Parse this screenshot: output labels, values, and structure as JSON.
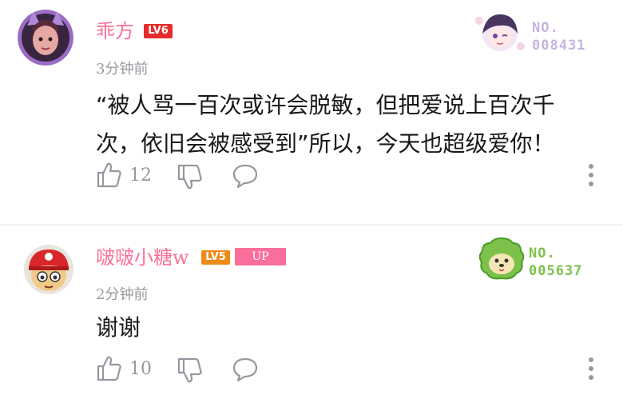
{
  "comments": [
    {
      "username": "乖方",
      "level": "LV6",
      "time": "3分钟前",
      "content": "“被人骂一百次或许会脱敏，但把爱说上百次千次，依旧会被感受到”所以，今天也超级爱你！",
      "likes": "12",
      "fan_no_label": "NO.",
      "fan_no_value": "008431"
    },
    {
      "username": "啵啵小糖w",
      "level": "LV5",
      "up_badge": "UP",
      "time": "2分钟前",
      "content": "谢谢",
      "likes": "10",
      "fan_no_label": "NO.",
      "fan_no_value": "005637"
    }
  ],
  "icons": [
    "like-icon",
    "dislike-icon",
    "reply-icon",
    "more-icon"
  ],
  "colors": {
    "username": "#fb7299",
    "lv6": "#e52b2b",
    "lv5": "#ee8a16",
    "up": "#f96e9a",
    "text": "#18191c",
    "muted": "#9499a0"
  }
}
